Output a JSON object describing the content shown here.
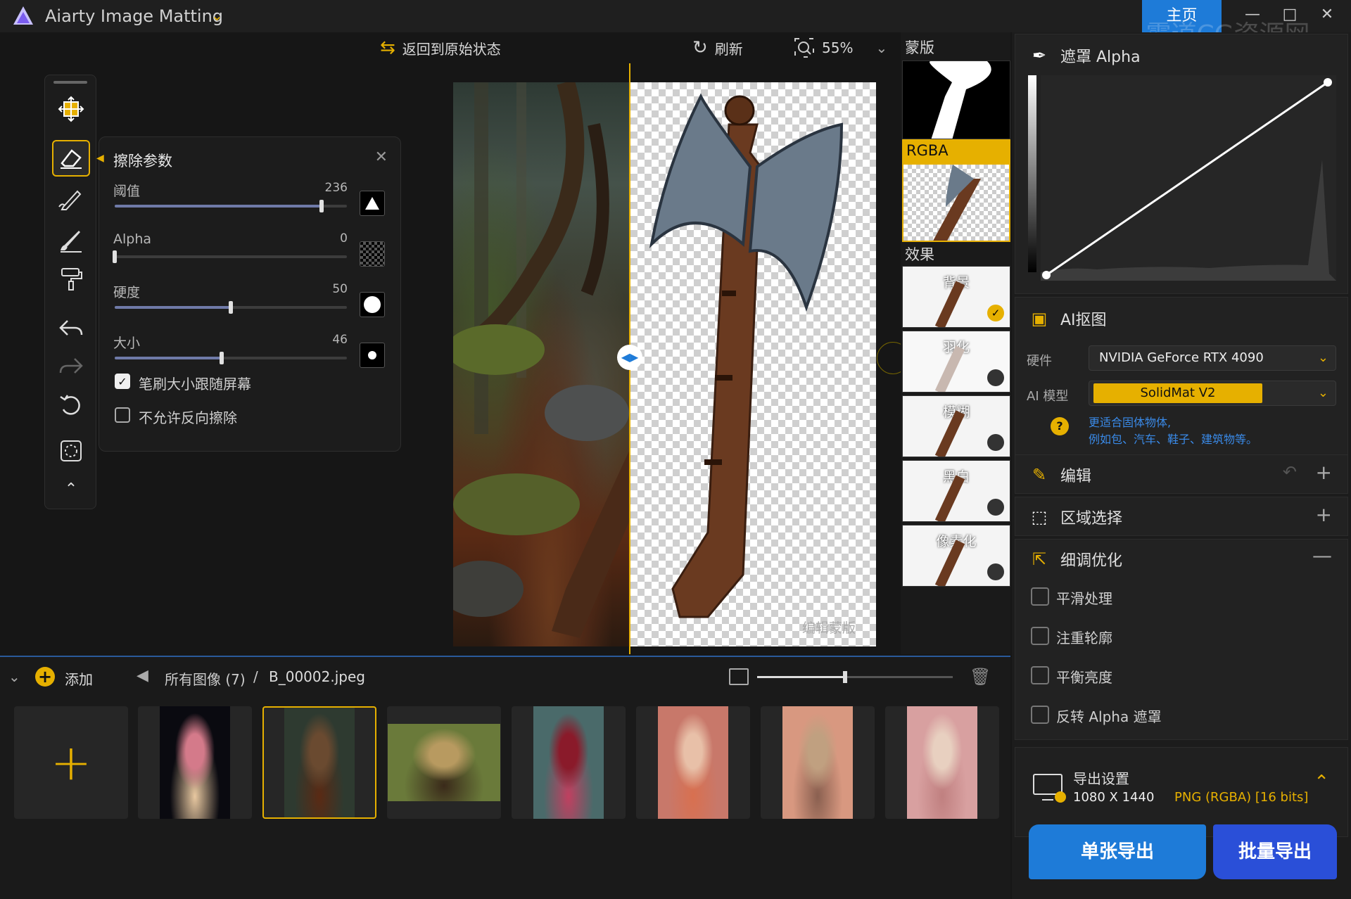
{
  "app": {
    "title": "Aiarty Image Matting",
    "home_tab": "主页",
    "watermark": "霸道CG资源网\nwww.badaocg.com"
  },
  "toolbar": {
    "reset_label": "返回到原始状态",
    "refresh_label": "刷新",
    "zoom": "55%"
  },
  "erase_panel": {
    "title": "擦除参数",
    "params": [
      {
        "label": "阈值",
        "value": "236",
        "fraction": 0.89
      },
      {
        "label": "Alpha",
        "value": "0",
        "fraction": 0.0
      },
      {
        "label": "硬度",
        "value": "50",
        "fraction": 0.5
      },
      {
        "label": "大小",
        "value": "46",
        "fraction": 0.46
      }
    ],
    "follow_screen_label": "笔刷大小跟随屏幕",
    "follow_screen_checked": true,
    "no_reverse_label": "不允许反向擦除",
    "no_reverse_checked": false
  },
  "canvas": {
    "edit_mask_label": "编辑蒙版"
  },
  "layers": {
    "mask_title": "蒙版",
    "rgba_title": "RGBA",
    "effects_title": "效果",
    "effects": [
      {
        "label": "背景",
        "selected": true
      },
      {
        "label": "羽化",
        "selected": false
      },
      {
        "label": "模糊",
        "selected": false
      },
      {
        "label": "黑白",
        "selected": false
      },
      {
        "label": "像素化",
        "selected": false
      }
    ]
  },
  "right_panel": {
    "alpha_title": "遮罩 Alpha",
    "ai_matting": {
      "title": "AI抠图",
      "hardware_label": "硬件",
      "hardware_value": "NVIDIA GeForce RTX 4090",
      "model_label": "AI 模型",
      "model_value": "SolidMat  V2",
      "model_hint_1": "更适合固体物体,",
      "model_hint_2": "例如包、汽车、鞋子、建筑物等。"
    },
    "edit_title": "编辑",
    "region_title": "区域选择",
    "refine": {
      "title": "细调优化",
      "options": [
        {
          "label": "平滑处理",
          "checked": false
        },
        {
          "label": "注重轮廓",
          "checked": false
        },
        {
          "label": "平衡亮度",
          "checked": false
        },
        {
          "label": "反转 Alpha 遮罩",
          "checked": false
        }
      ]
    },
    "export_settings": {
      "title": "导出设置",
      "size": "1080 X 1440",
      "format": "PNG (RGBA) [16 bits]"
    },
    "export_single": "单张导出",
    "export_batch": "批量导出"
  },
  "bottom": {
    "add_label": "添加",
    "all_images": "所有图像 (7)",
    "separator": "/",
    "current_file": "B_00002.jpeg",
    "thumb_size_fraction": 0.45,
    "thumbnails": [
      {
        "name": "jellyfish",
        "colors": [
          "#0a0a10",
          "#d47a8a",
          "#e8c8a0"
        ]
      },
      {
        "name": "axe-forest",
        "colors": [
          "#2e3a30",
          "#6a4a30",
          "#5a2a14"
        ],
        "selected": true
      },
      {
        "name": "bicycle",
        "colors": [
          "#6a7a3a",
          "#b89a60",
          "#3a2a1a"
        ]
      },
      {
        "name": "woman-red-dress",
        "colors": [
          "#4a6a6a",
          "#8a1a2a",
          "#c04060"
        ]
      },
      {
        "name": "woman-flowers",
        "colors": [
          "#c8786a",
          "#e8c0a8",
          "#d87050"
        ]
      },
      {
        "name": "woman-gold",
        "colors": [
          "#d89880",
          "#c0a080",
          "#8a6050"
        ]
      },
      {
        "name": "woman-pink",
        "colors": [
          "#d8a0a0",
          "#e8d0c0",
          "#c08080"
        ]
      }
    ]
  }
}
